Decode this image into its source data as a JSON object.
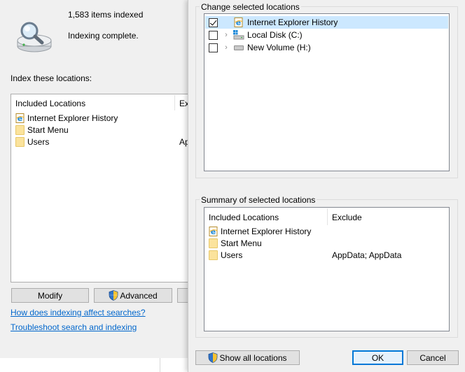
{
  "background": {
    "items_indexed": "1,583 items indexed",
    "status": "Indexing complete.",
    "index_label": "Index these locations:",
    "columns": {
      "included": "Included Locations",
      "exclude": "Ex"
    },
    "rows": [
      {
        "name": "Internet Explorer History",
        "exclude": "",
        "icon": "ie-icon"
      },
      {
        "name": "Start Menu",
        "exclude": "",
        "icon": "folder-icon"
      },
      {
        "name": "Users",
        "exclude": "Ap",
        "icon": "folder-icon"
      }
    ],
    "buttons": {
      "modify": "Modify",
      "advanced": "Advanced"
    },
    "links": {
      "how": "How does indexing affect searches?",
      "troubleshoot": "Troubleshoot search and indexing"
    }
  },
  "dialog": {
    "change_label": "Change selected locations",
    "tree": [
      {
        "label": "Internet Explorer History",
        "checked": true,
        "expandable": false,
        "icon": "ie-icon",
        "selected": true
      },
      {
        "label": "Local Disk (C:)",
        "checked": false,
        "expandable": true,
        "icon": "windows-drive-icon",
        "selected": false
      },
      {
        "label": "New Volume (H:)",
        "checked": false,
        "expandable": true,
        "icon": "drive-icon",
        "selected": false
      }
    ],
    "summary_label": "Summary of selected locations",
    "summary_columns": {
      "included": "Included Locations",
      "exclude": "Exclude"
    },
    "summary_rows": [
      {
        "name": "Internet Explorer History",
        "exclude": "",
        "icon": "ie-icon"
      },
      {
        "name": "Start Menu",
        "exclude": "",
        "icon": "folder-icon"
      },
      {
        "name": "Users",
        "exclude": "AppData; AppData",
        "icon": "folder-icon"
      }
    ],
    "buttons": {
      "show_all": "Show all locations",
      "ok": "OK",
      "cancel": "Cancel"
    },
    "colors": {
      "accent": "#0078d7",
      "selection": "#cce8ff",
      "link": "#0066cc"
    }
  }
}
